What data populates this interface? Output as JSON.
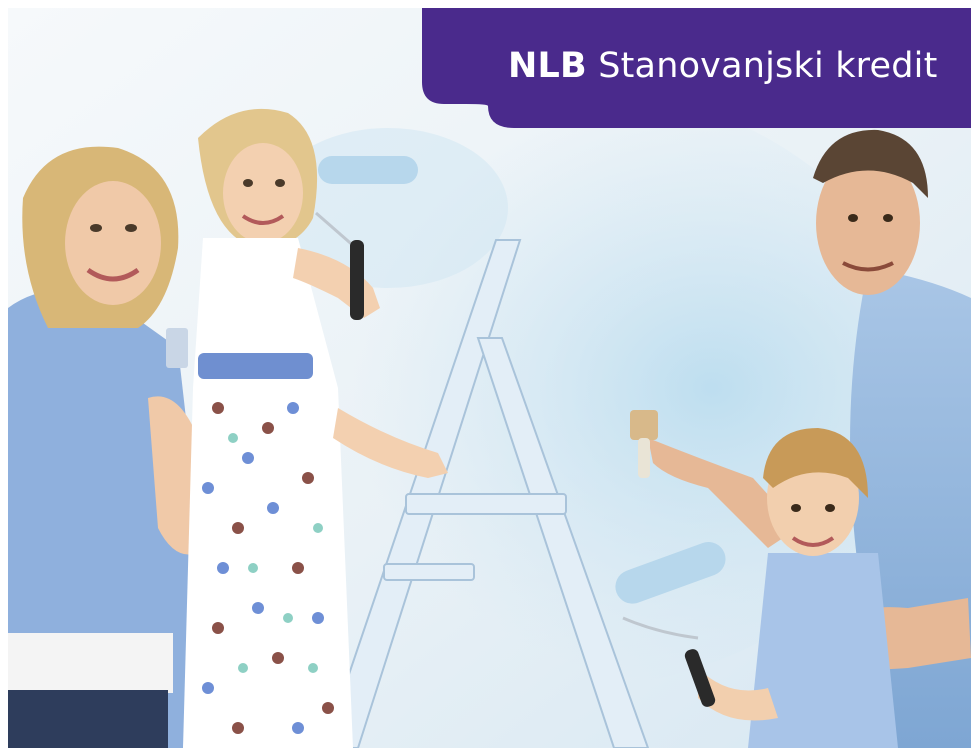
{
  "banner": {
    "brand": "NLB",
    "product": "Stanovanjski kredit",
    "color": "#4a2a8c"
  }
}
